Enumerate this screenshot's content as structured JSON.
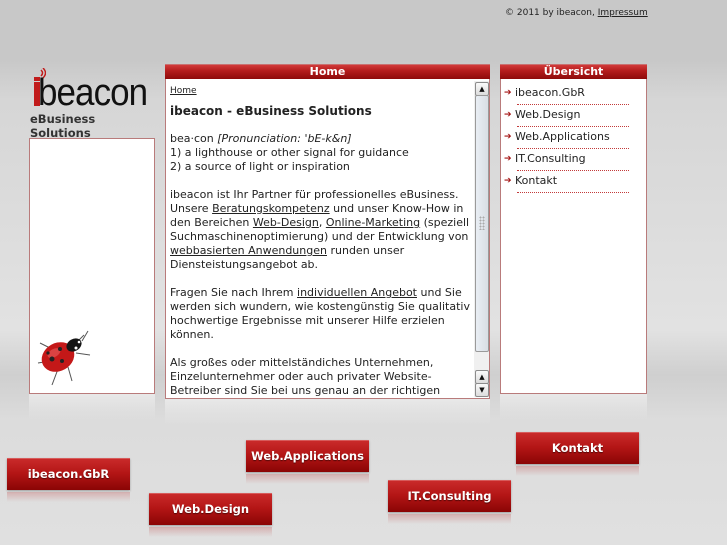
{
  "header": {
    "copyright": "© 2011 by ibeacon,",
    "impressum_link": "Impressum"
  },
  "logo": {
    "wordmark": "beacon",
    "tagline": "eBusiness Solutions"
  },
  "main": {
    "panel_title": "Home",
    "breadcrumb": "Home",
    "heading": "ibeacon - eBusiness Solutions",
    "definition": {
      "word": "bea·con ",
      "pronunciation": "[Pronunciation: 'bE-k&n]",
      "line1": "1) a lighthouse or other signal for guidance",
      "line2": "2) a source of light or inspiration"
    },
    "para1": {
      "t1": "ibeacon ist Ihr Partner für professionelles eBusiness. Unsere ",
      "link1": "Beratungskompetenz",
      "t2": " und unser Know-How in den Bereichen ",
      "link2": "Web-Design",
      "t3": ", ",
      "link3": "Online-Marketing",
      "t4": " (speziell Suchmaschinenoptimierung) und der Entwicklung von ",
      "link4": "webbasierten Anwendungen",
      "t5": " runden unser Diensteistungsangebot ab."
    },
    "para2": {
      "t1": "Fragen Sie nach Ihrem ",
      "link1": "individuellen Angebot",
      "t2": " und Sie werden sich wundern, wie kostengünstig Sie qualitativ hochwertige Ergebnisse mit unserer Hilfe erzielen können."
    },
    "para3": "Als großes oder mittelständiches Unternehmen, Einzelunternehmer oder auch privater Website-Betreiber sind Sie bei uns genau an der richtigen"
  },
  "sidebar": {
    "title": "Übersicht",
    "items": [
      {
        "label": "ibeacon.GbR"
      },
      {
        "label": "Web.Design"
      },
      {
        "label": "Web.Applications"
      },
      {
        "label": "IT.Consulting"
      },
      {
        "label": "Kontakt"
      }
    ]
  },
  "bottom_nav": {
    "gbr": "ibeacon.GbR",
    "design": "Web.Design",
    "applications": "Web.Applications",
    "consulting": "IT.Consulting",
    "kontakt": "Kontakt"
  },
  "colors": {
    "brand_red": "#b51d1d",
    "border": "#b97b7b"
  }
}
